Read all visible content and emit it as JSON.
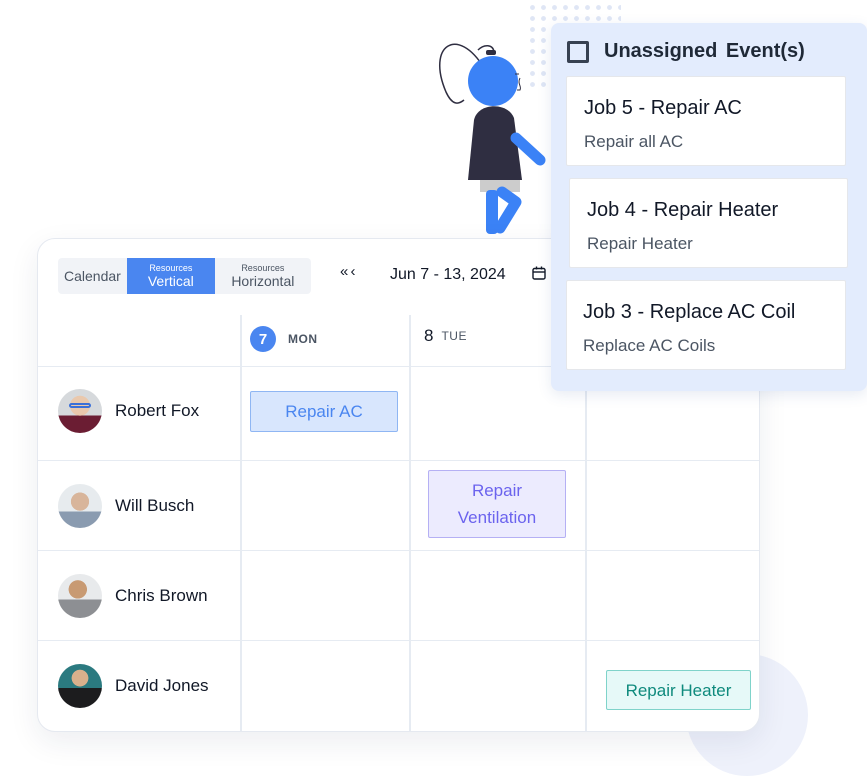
{
  "toolbar": {
    "views": [
      {
        "label": "Calendar",
        "sublabel": ""
      },
      {
        "label": "Vertical",
        "sublabel": "Resources",
        "active": true
      },
      {
        "label": "Horizontal",
        "sublabel": "Resources"
      }
    ],
    "nav_prev_label": "<< <",
    "date_range": "Jun 7 - 13, 2024",
    "calendar_icon": "calendar-icon"
  },
  "days": [
    {
      "number": "7",
      "name": "MON",
      "today": true
    },
    {
      "number": "8",
      "name": "TUE",
      "today": false
    }
  ],
  "resources": [
    {
      "name": "Robert Fox",
      "avatar": "avatar-robert-fox"
    },
    {
      "name": "Will Busch",
      "avatar": "avatar-will-busch"
    },
    {
      "name": "Chris Brown",
      "avatar": "avatar-chris-brown"
    },
    {
      "name": "David Jones",
      "avatar": "avatar-david-jones"
    }
  ],
  "events": [
    {
      "label": "Repair AC",
      "resource": "Robert Fox",
      "day": "7",
      "color": "#4a86f0"
    },
    {
      "label": "Repair Ventilation",
      "resource": "Will Busch",
      "day": "8",
      "color": "#6b63ee"
    },
    {
      "label": "Repair Heater",
      "resource": "David Jones",
      "day": "9",
      "color": "#0f8a7d"
    }
  ],
  "unassigned": {
    "title": "Unassigned  Event(s)",
    "checked": false,
    "jobs": [
      {
        "title": "Job 5 - Repair AC",
        "description": "Repair all AC"
      },
      {
        "title": "Job 4 - Repair Heater",
        "description": "Repair Heater"
      },
      {
        "title": "Job 3 - Replace AC Coil",
        "description": "Replace AC Coils"
      }
    ]
  },
  "colors": {
    "accent": "#4a86f0",
    "panel_bg": "#e3ecfd",
    "figure_blue": "#3b82f6",
    "figure_dark": "#2f2e41"
  }
}
